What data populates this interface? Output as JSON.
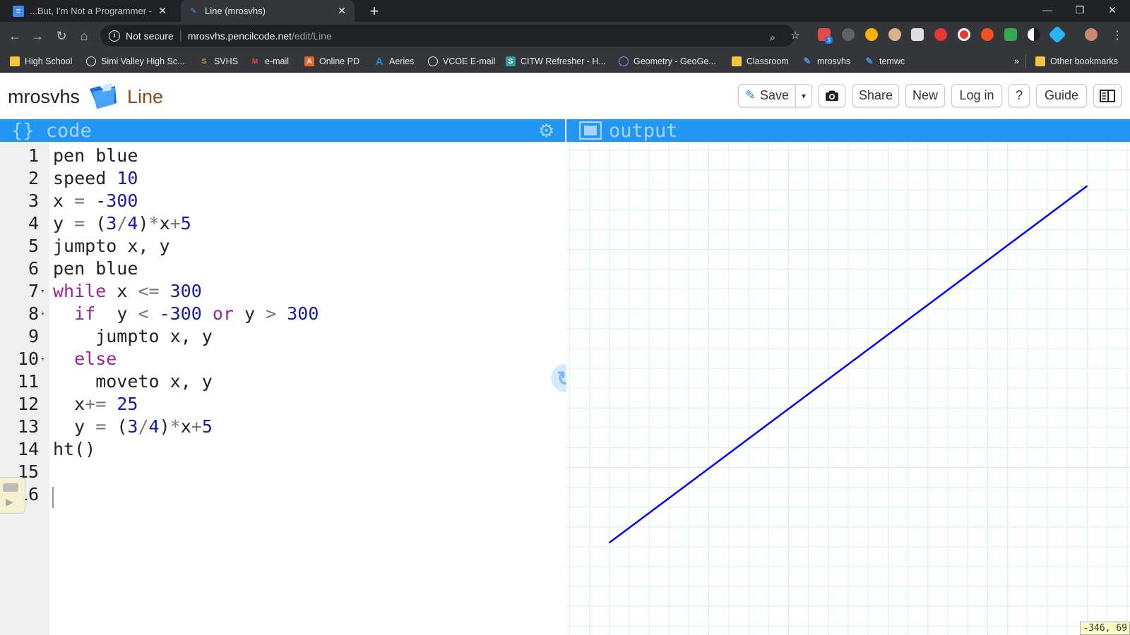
{
  "browser": {
    "tabs": [
      {
        "title": "...But, I'm Not a Programmer - G",
        "favicon": "docs-icon",
        "active": false
      },
      {
        "title": "Line (mrosvhs)",
        "favicon": "pencil-icon",
        "active": true
      }
    ],
    "newtab_label": "+",
    "address": {
      "security_label": "Not secure",
      "host": "mrosvhs.pencilcode.net",
      "path": "/edit/Line"
    },
    "extension_badge": "3",
    "bookmarks": [
      {
        "label": "High School",
        "icon": "folder-icon",
        "color": "#f4c542"
      },
      {
        "label": "Simi Valley High Sc...",
        "icon": "globe-icon",
        "color": "#e8eaed"
      },
      {
        "label": "SVHS",
        "icon": "s-icon",
        "color": "#c8a24a"
      },
      {
        "label": "e-mail",
        "icon": "gmail-icon",
        "color": "#ea4335"
      },
      {
        "label": "Online PD",
        "icon": "a-icon",
        "color": "#e0662a"
      },
      {
        "label": "Aeries",
        "icon": "aeries-icon",
        "color": "#1e88e5"
      },
      {
        "label": "VCOE E-mail",
        "icon": "globe-icon",
        "color": "#e8eaed"
      },
      {
        "label": "CITW Refresher - H...",
        "icon": "sharepoint-icon",
        "color": "#2e9e9e"
      },
      {
        "label": "Geometry - GeoGe...",
        "icon": "geogebra-icon",
        "color": "#9c8cf0"
      },
      {
        "label": "Classroom",
        "icon": "classroom-icon",
        "color": "#f4c542"
      },
      {
        "label": "mrosvhs",
        "icon": "pencil-icon",
        "color": "#4a90e2"
      },
      {
        "label": "temwc",
        "icon": "pencil-icon",
        "color": "#4a90e2"
      }
    ],
    "more_bookmarks": "»",
    "other_bookmarks": "Other bookmarks"
  },
  "app": {
    "brand": "mrosvhs",
    "project_name": "Line",
    "buttons": {
      "save": "Save",
      "save_menu": "▾",
      "share": "Share",
      "new": "New",
      "login": "Log in",
      "help": "?",
      "guide": "Guide"
    }
  },
  "code_pane": {
    "title": "{} code",
    "lines": [
      {
        "n": "1",
        "fold": "",
        "tokens": [
          [
            "t",
            "pen blue"
          ]
        ]
      },
      {
        "n": "2",
        "fold": "",
        "tokens": [
          [
            "t",
            "speed "
          ],
          [
            "num",
            "10"
          ]
        ]
      },
      {
        "n": "3",
        "fold": "",
        "tokens": [
          [
            "t",
            "x "
          ],
          [
            "op",
            "="
          ],
          [
            "t",
            " "
          ],
          [
            "num",
            "-300"
          ]
        ]
      },
      {
        "n": "4",
        "fold": "",
        "tokens": [
          [
            "t",
            "y "
          ],
          [
            "op",
            "="
          ],
          [
            "t",
            " ("
          ],
          [
            "num",
            "3"
          ],
          [
            "op",
            "/"
          ],
          [
            "num",
            "4"
          ],
          [
            "t",
            ")"
          ],
          [
            "op",
            "*"
          ],
          [
            "t",
            "x"
          ],
          [
            "op",
            "+"
          ],
          [
            "num",
            "5"
          ]
        ]
      },
      {
        "n": "5",
        "fold": "",
        "tokens": [
          [
            "t",
            "jumpto x, y"
          ]
        ]
      },
      {
        "n": "6",
        "fold": "",
        "tokens": [
          [
            "t",
            "pen blue"
          ]
        ]
      },
      {
        "n": "7",
        "fold": "▾",
        "tokens": [
          [
            "kw",
            "while"
          ],
          [
            "t",
            " x "
          ],
          [
            "op",
            "<="
          ],
          [
            "t",
            " "
          ],
          [
            "num",
            "300"
          ]
        ]
      },
      {
        "n": "8",
        "fold": "▾",
        "tokens": [
          [
            "t",
            "  "
          ],
          [
            "kw",
            "if"
          ],
          [
            "t",
            "  y "
          ],
          [
            "op",
            "<"
          ],
          [
            "t",
            " "
          ],
          [
            "num",
            "-300"
          ],
          [
            "t",
            " "
          ],
          [
            "kw",
            "or"
          ],
          [
            "t",
            " y "
          ],
          [
            "op",
            ">"
          ],
          [
            "t",
            " "
          ],
          [
            "num",
            "300"
          ]
        ]
      },
      {
        "n": "9",
        "fold": "",
        "tokens": [
          [
            "t",
            "    jumpto x, y"
          ]
        ]
      },
      {
        "n": "10",
        "fold": "▾",
        "tokens": [
          [
            "t",
            "  "
          ],
          [
            "kw",
            "else"
          ]
        ]
      },
      {
        "n": "11",
        "fold": "",
        "tokens": [
          [
            "t",
            "    moveto x, y"
          ]
        ]
      },
      {
        "n": "12",
        "fold": "",
        "tokens": [
          [
            "t",
            "  x"
          ],
          [
            "op",
            "+="
          ],
          [
            "t",
            " "
          ],
          [
            "num",
            "25"
          ]
        ]
      },
      {
        "n": "13",
        "fold": "",
        "tokens": [
          [
            "t",
            "  y "
          ],
          [
            "op",
            "="
          ],
          [
            "t",
            " ("
          ],
          [
            "num",
            "3"
          ],
          [
            "op",
            "/"
          ],
          [
            "num",
            "4"
          ],
          [
            "t",
            ")"
          ],
          [
            "op",
            "*"
          ],
          [
            "t",
            "x"
          ],
          [
            "op",
            "+"
          ],
          [
            "num",
            "5"
          ]
        ]
      },
      {
        "n": "14",
        "fold": "",
        "tokens": [
          [
            "t",
            "ht()"
          ]
        ]
      },
      {
        "n": "15",
        "fold": "",
        "tokens": []
      },
      {
        "n": "16",
        "fold": "",
        "tokens": []
      }
    ]
  },
  "output_pane": {
    "title": "output",
    "grid_step": 25,
    "line": {
      "color": "#0000ff",
      "from": [
        -300,
        -220
      ],
      "to": [
        300,
        230
      ]
    },
    "coord_readout": "-346, 69"
  },
  "colors": {
    "pane_bar": "#2196f3",
    "keyword": "#9b2393",
    "number": "#1a1aa6",
    "grid": "#d6f0f0"
  }
}
